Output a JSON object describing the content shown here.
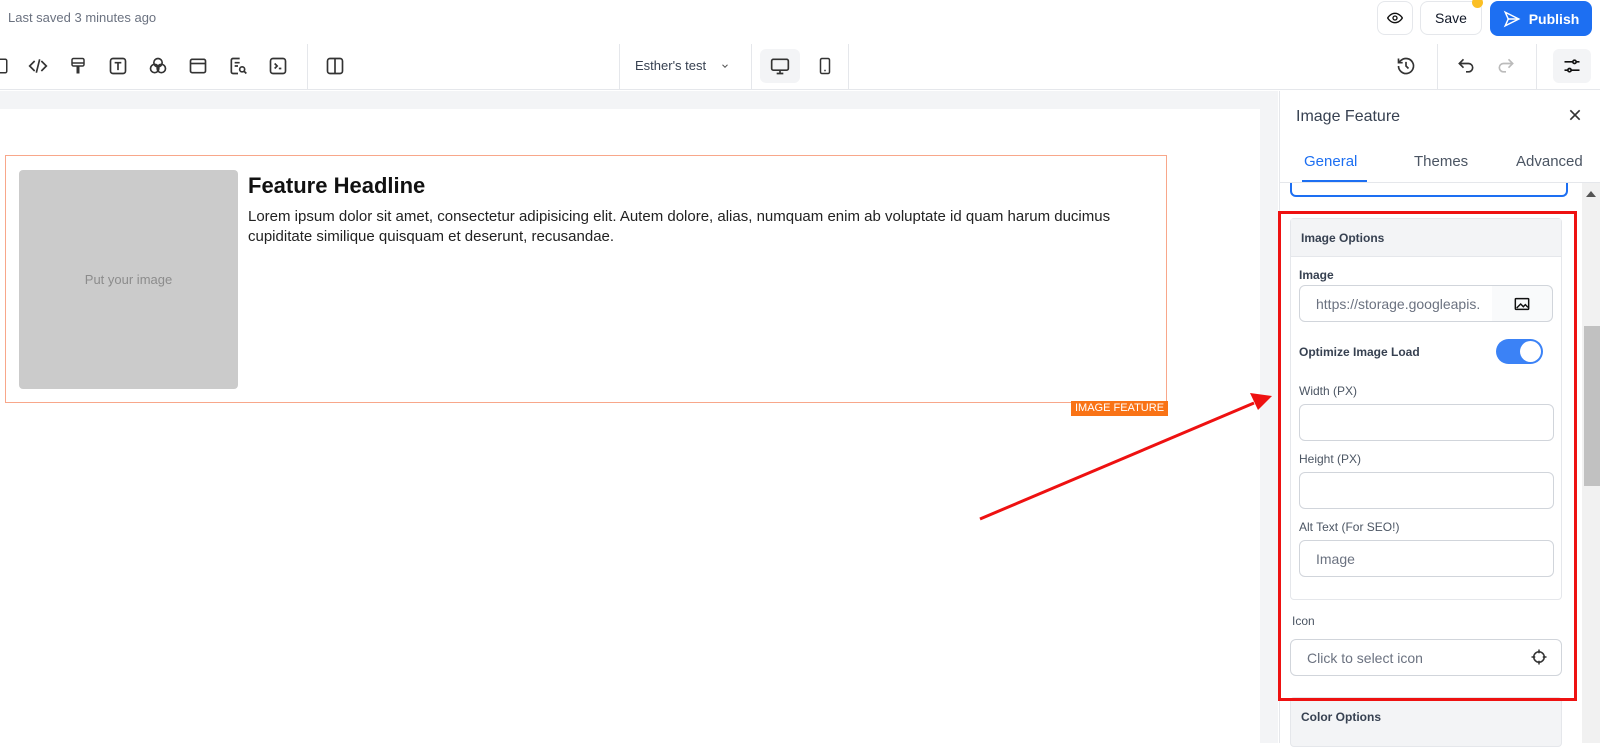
{
  "header": {
    "saved_status": "Last saved 3 minutes ago",
    "save_label": "Save",
    "publish_label": "Publish"
  },
  "toolbar": {
    "page_name": "Esther's test"
  },
  "canvas": {
    "image_placeholder": "Put your image",
    "headline": "Feature Headline",
    "body": "Lorem ipsum dolor sit amet, consectetur adipisicing elit. Autem dolore, alias, numquam enim ab voluptate id quam harum ducimus cupiditate similique quisquam et deserunt, recusandae.",
    "badge": "IMAGE FEATURE"
  },
  "panel": {
    "title": "Image Feature",
    "tabs": [
      {
        "label": "General"
      },
      {
        "label": "Themes"
      },
      {
        "label": "Advanced"
      }
    ],
    "image_options": {
      "header": "Image Options",
      "image_label": "Image",
      "image_value": "https://storage.googleapis.",
      "optimize_label": "Optimize Image Load",
      "optimize_on": true,
      "width_label": "Width (PX)",
      "width_value": "",
      "height_label": "Height (PX)",
      "height_value": "",
      "alt_label": "Alt Text (For SEO!)",
      "alt_placeholder": "Image"
    },
    "icon": {
      "label": "Icon",
      "placeholder": "Click to select icon"
    },
    "color_options": {
      "header": "Color Options"
    }
  },
  "colors": {
    "accent": "#1d6ff2",
    "badge": "#f97316",
    "highlight": "#ee1111",
    "toggle": "#3b82f6"
  }
}
